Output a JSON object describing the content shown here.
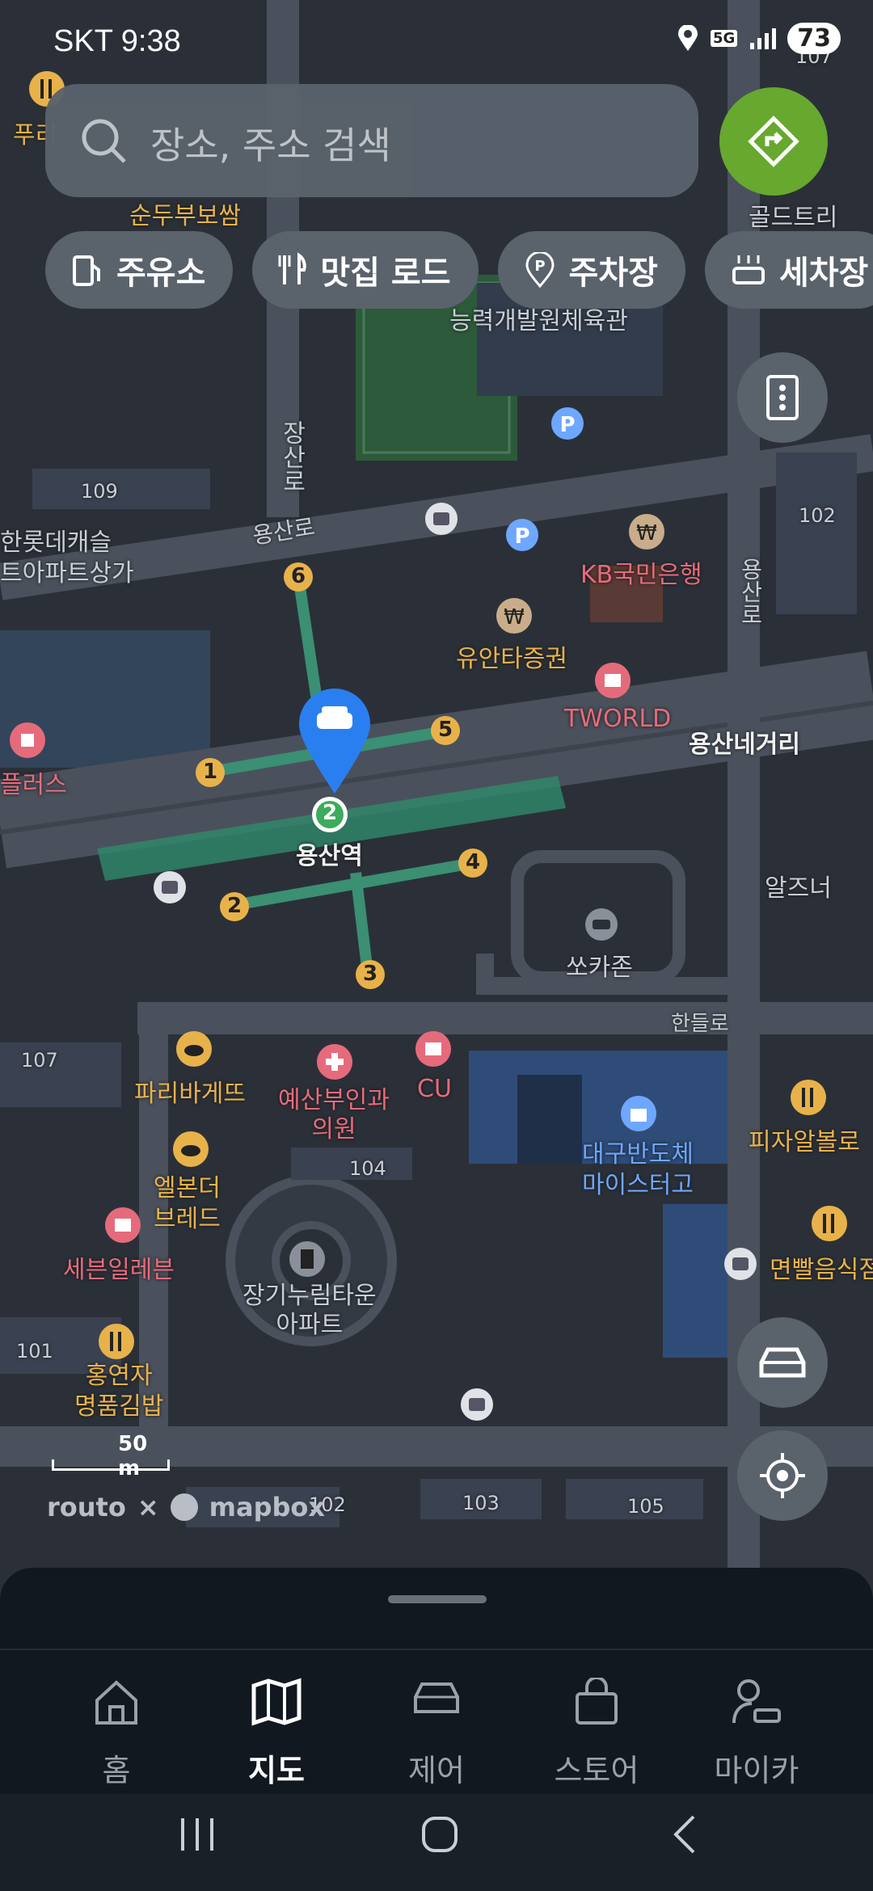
{
  "status": {
    "carrier": "SKT",
    "time": "9:38",
    "network": "5G",
    "battery": "73"
  },
  "search": {
    "placeholder": "장소, 주소 검색"
  },
  "chips": [
    {
      "label": "주유소",
      "icon": "gas-station-icon"
    },
    {
      "label": "맛집 로드",
      "icon": "restaurant-icon"
    },
    {
      "label": "주차장",
      "icon": "parking-icon"
    },
    {
      "label": "세차장",
      "icon": "car-wash-icon"
    }
  ],
  "map": {
    "labels": {
      "gold_tree": "골드트리",
      "sundubu": "순두부보쌈",
      "puri": "푸리",
      "center": "능력개발원체육관",
      "jangsanro": "장산로",
      "yongsanro_top": "용산로",
      "yongsanro_right": "용산로",
      "lotte": "한롯데캐슬",
      "lotte2": "트아파트상가",
      "kb": "KB국민은행",
      "yuanta": "유안타증권",
      "tworld": "TWORLD",
      "yongsan_crossroad": "용산네거리",
      "station": "용산역",
      "plus": "플러스",
      "aljeuneo": "알즈너",
      "socarzone": "쏘카존",
      "handeulro": "한들로",
      "paris": "파리바게뜨",
      "yesan": "예산부인과\n의원",
      "cu": "CU",
      "pizza": "피자알볼로",
      "daegu": "대구반도체\n마이스터고",
      "elbon": "엘본더\n브레드",
      "seven": "세븐일레븐",
      "jangginurim": "장기누림타운\n아파트",
      "noodle": "면빨음식점",
      "hongyeonja": "홍연자\n명품김밥",
      "b109": "109",
      "b102a": "102",
      "b107a": "107",
      "b107b": "107",
      "b104": "104",
      "b101": "101",
      "b102b": "102",
      "b103": "103",
      "b105": "105",
      "exit1": "1",
      "exit2": "2",
      "exit3": "3",
      "exit4": "4",
      "exit5": "5",
      "exit6": "6",
      "line2": "2",
      "parking_p1": "P",
      "parking_p2": "P",
      "won1": "₩",
      "won2": "₩"
    },
    "scale": "50 m",
    "attribution_left": "routo",
    "attribution_x": "×",
    "attribution_right": "mapbox"
  },
  "bottom_nav": [
    {
      "label": "홈",
      "icon": "home-icon"
    },
    {
      "label": "지도",
      "icon": "map-icon",
      "active": true
    },
    {
      "label": "제어",
      "icon": "car-icon"
    },
    {
      "label": "스토어",
      "icon": "store-bag-icon"
    },
    {
      "label": "마이카",
      "icon": "my-car-person-icon"
    }
  ],
  "colors": {
    "accent": "#67a82f",
    "map_bg": "#2f343d",
    "route_green": "#3b8f73"
  }
}
